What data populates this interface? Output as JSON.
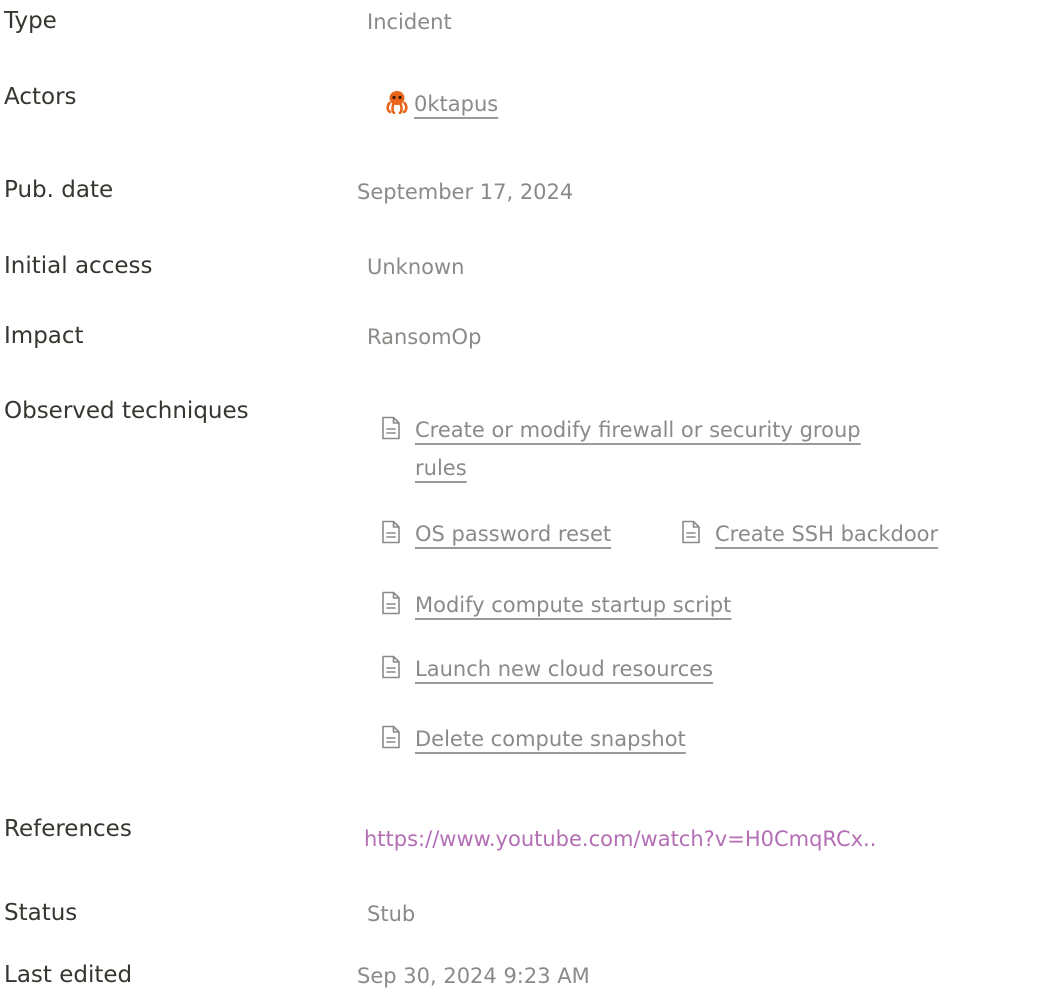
{
  "properties": {
    "type": {
      "label": "Type",
      "value": "Incident"
    },
    "actors": {
      "label": "Actors",
      "items": [
        {
          "name": "0ktapus",
          "icon": "octopus-icon"
        }
      ]
    },
    "pub_date": {
      "label": "Pub. date",
      "value": "September 17, 2024"
    },
    "initial_access": {
      "label": "Initial access",
      "value": "Unknown"
    },
    "impact": {
      "label": "Impact",
      "value": "RansomOp"
    },
    "observed_techniques": {
      "label": "Observed techniques",
      "items": [
        {
          "line1": "Create or modify firewall or security group",
          "line2": "rules",
          "icon": "document-icon"
        },
        {
          "text": "OS password reset",
          "icon": "document-icon"
        },
        {
          "text": "Create SSH backdoor",
          "icon": "document-icon"
        },
        {
          "text": "Modify compute startup script",
          "icon": "document-icon"
        },
        {
          "text": "Launch new cloud resources",
          "icon": "document-icon"
        },
        {
          "text": "Delete compute snapshot",
          "icon": "document-icon"
        }
      ]
    },
    "references": {
      "label": "References",
      "value": "https://www.youtube.com/watch?v=H0CmqRCx.."
    },
    "status": {
      "label": "Status",
      "value": "Stub"
    },
    "last_edited": {
      "label": "Last edited",
      "value": "Sep 30, 2024 9:23 AM"
    }
  },
  "colors": {
    "label": "#37352f",
    "value": "#8a8a87",
    "reference_link": "#b46eb4",
    "actor_icon": "#e8651a"
  }
}
